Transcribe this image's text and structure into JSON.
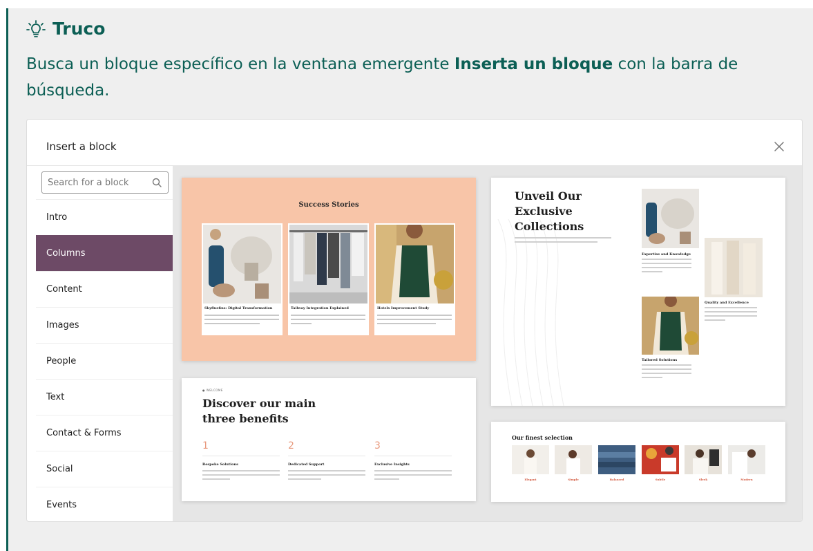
{
  "tip": {
    "title": "Truco",
    "text_before": "Busca un bloque específico en la ventana emergente ",
    "text_bold": "Inserta un bloque",
    "text_after": " con la barra de búsqueda.",
    "accent_color": "#0c5f55",
    "icon": "lightbulb-icon"
  },
  "modal": {
    "title": "Insert a block",
    "close_icon": "close-icon",
    "search": {
      "placeholder": "Search for a block",
      "value": "",
      "icon": "search-icon"
    },
    "categories": [
      "Intro",
      "Columns",
      "Content",
      "Images",
      "People",
      "Text",
      "Contact & Forms",
      "Social",
      "Events"
    ],
    "active_category": "Columns",
    "active_color": "#6d4a66"
  },
  "patterns": {
    "success": {
      "title": "Success Stories",
      "cards": [
        "Skyfluefins: Digital Transformation",
        "Tailway Integration Explained",
        "Hotels Improvement Study"
      ],
      "background": "#f8c5a8"
    },
    "collections": {
      "title": "Unveil Our Exclusive Collections",
      "features": [
        "Expertise and Knowledge",
        "Quality and Excellence",
        "Tailored Solutions"
      ]
    },
    "benefits": {
      "kicker": "● WELCOME",
      "title": "Discover our main three benefits",
      "items": [
        {
          "num": "1",
          "head": "Bespoke Solutions"
        },
        {
          "num": "2",
          "head": "Dedicated Support"
        },
        {
          "num": "3",
          "head": "Exclusive Insights"
        }
      ]
    },
    "selection": {
      "title": "Our finest selection",
      "items": [
        "Elegant",
        "Simple",
        "Balanced",
        "Subtle",
        "Sleek",
        "Modern"
      ]
    }
  }
}
